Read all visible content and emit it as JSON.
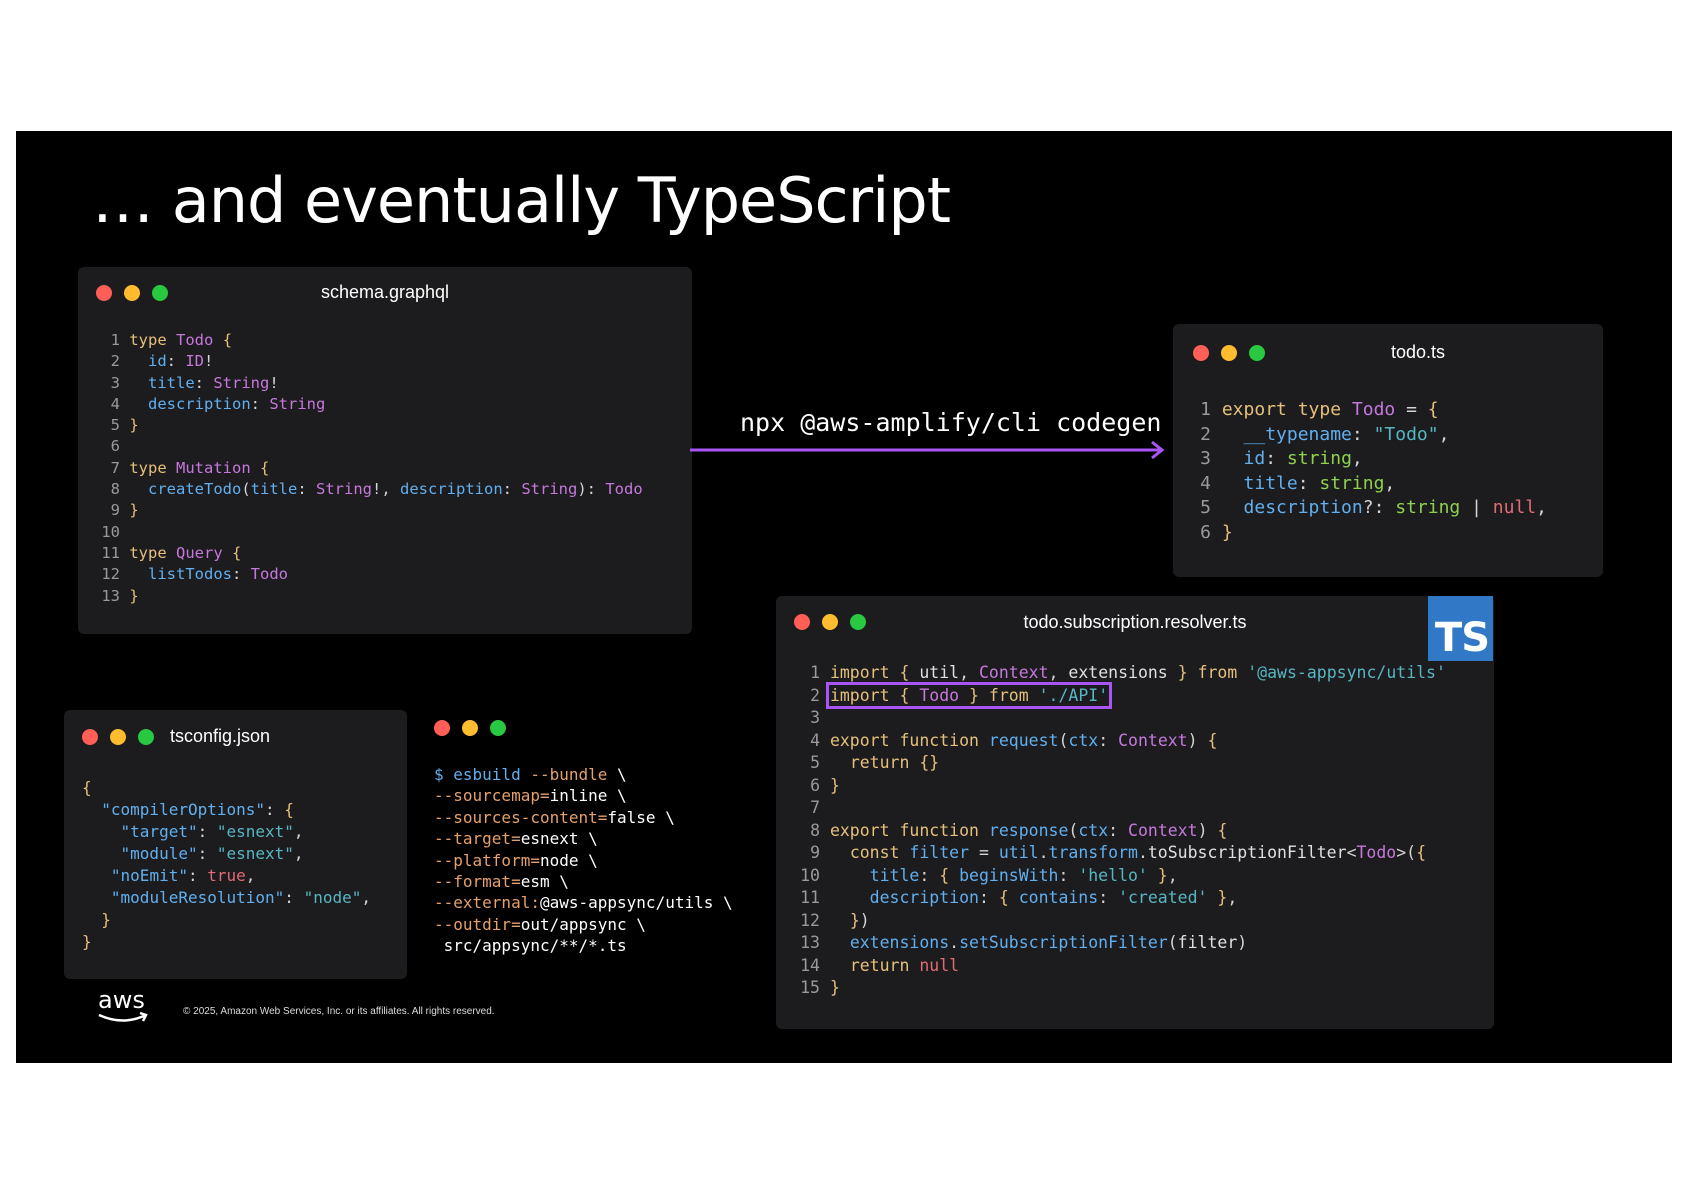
{
  "slide": {
    "title": "… and eventually TypeScript",
    "footer": "© 2025, Amazon Web Services, Inc. or its affiliates. All rights reserved.",
    "logo_text": "aws",
    "arrow_label": "npx @aws-amplify/cli codegen",
    "ts_badge": "TS"
  },
  "windows": {
    "schema": {
      "title": "schema.graphql"
    },
    "todo": {
      "title": "todo.ts"
    },
    "resolver": {
      "title": "todo.subscription.resolver.ts"
    },
    "tsconfig": {
      "title": "tsconfig.json"
    }
  },
  "colors": {
    "accent_purple": "#a855f7",
    "ts_blue": "#3178c6",
    "window_bg": "#1c1c1e"
  },
  "code": {
    "schema": [
      "type Todo {",
      "  id: ID!",
      "  title: String!",
      "  description: String",
      "}",
      "",
      "type Mutation {",
      "  createTodo(title: String!, description: String): Todo",
      "}",
      "",
      "type Query {",
      "  listTodos: Todo",
      "}"
    ],
    "todo": [
      "export type Todo = {",
      "  __typename: \"Todo\",",
      "  id: string,",
      "  title: string,",
      "  description?: string | null,",
      "}"
    ],
    "resolver": [
      "import { util, Context, extensions } from '@aws-appsync/utils'",
      "import { Todo } from './API'",
      "",
      "export function request(ctx: Context) {",
      "  return {}",
      "}",
      "",
      "export function response(ctx: Context) {",
      "  const filter = util.transform.toSubscriptionFilter<Todo>({",
      "    title: { beginsWith: 'hello' },",
      "    description: { contains: 'created' },",
      "  })",
      "  extensions.setSubscriptionFilter(filter)",
      "  return null",
      "}"
    ],
    "tsconfig": [
      "{",
      "  \"compilerOptions\": {",
      "    \"target\": \"esnext\",",
      "    \"module\": \"esnext\",",
      "   \"noEmit\": true,",
      "   \"moduleResolution\": \"node\",",
      "  }",
      "}"
    ],
    "esbuild": [
      "$ esbuild --bundle \\",
      "--sourcemap=inline \\",
      "--sources-content=false \\",
      "--target=esnext \\",
      "--platform=node \\",
      "--format=esm \\",
      "--external:@aws-appsync/utils \\",
      "--outdir=out/appsync \\",
      " src/appsync/**/*.ts"
    ]
  }
}
